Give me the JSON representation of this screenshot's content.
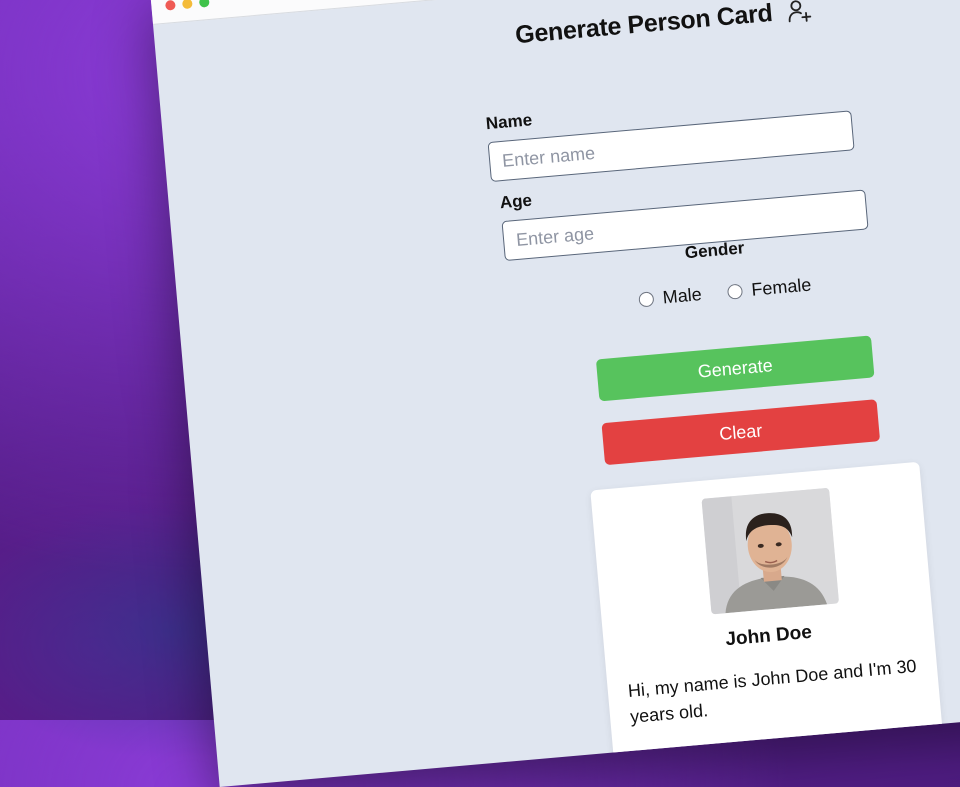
{
  "header": {
    "title": "Generate Person Card",
    "icon": "person-add-icon"
  },
  "form": {
    "name_label": "Name",
    "name_placeholder": "Enter name",
    "name_value": "",
    "age_label": "Age",
    "age_placeholder": "Enter age",
    "age_value": "",
    "gender_label": "Gender",
    "gender_options": [
      "Male",
      "Female"
    ],
    "generate_label": "Generate",
    "clear_label": "Clear"
  },
  "card": {
    "name": "John Doe",
    "bio": "Hi, my name is John Doe and I'm 30 years old."
  },
  "colors": {
    "generate": "#57c35d",
    "clear": "#e34141",
    "background": "#e0e6f0"
  }
}
